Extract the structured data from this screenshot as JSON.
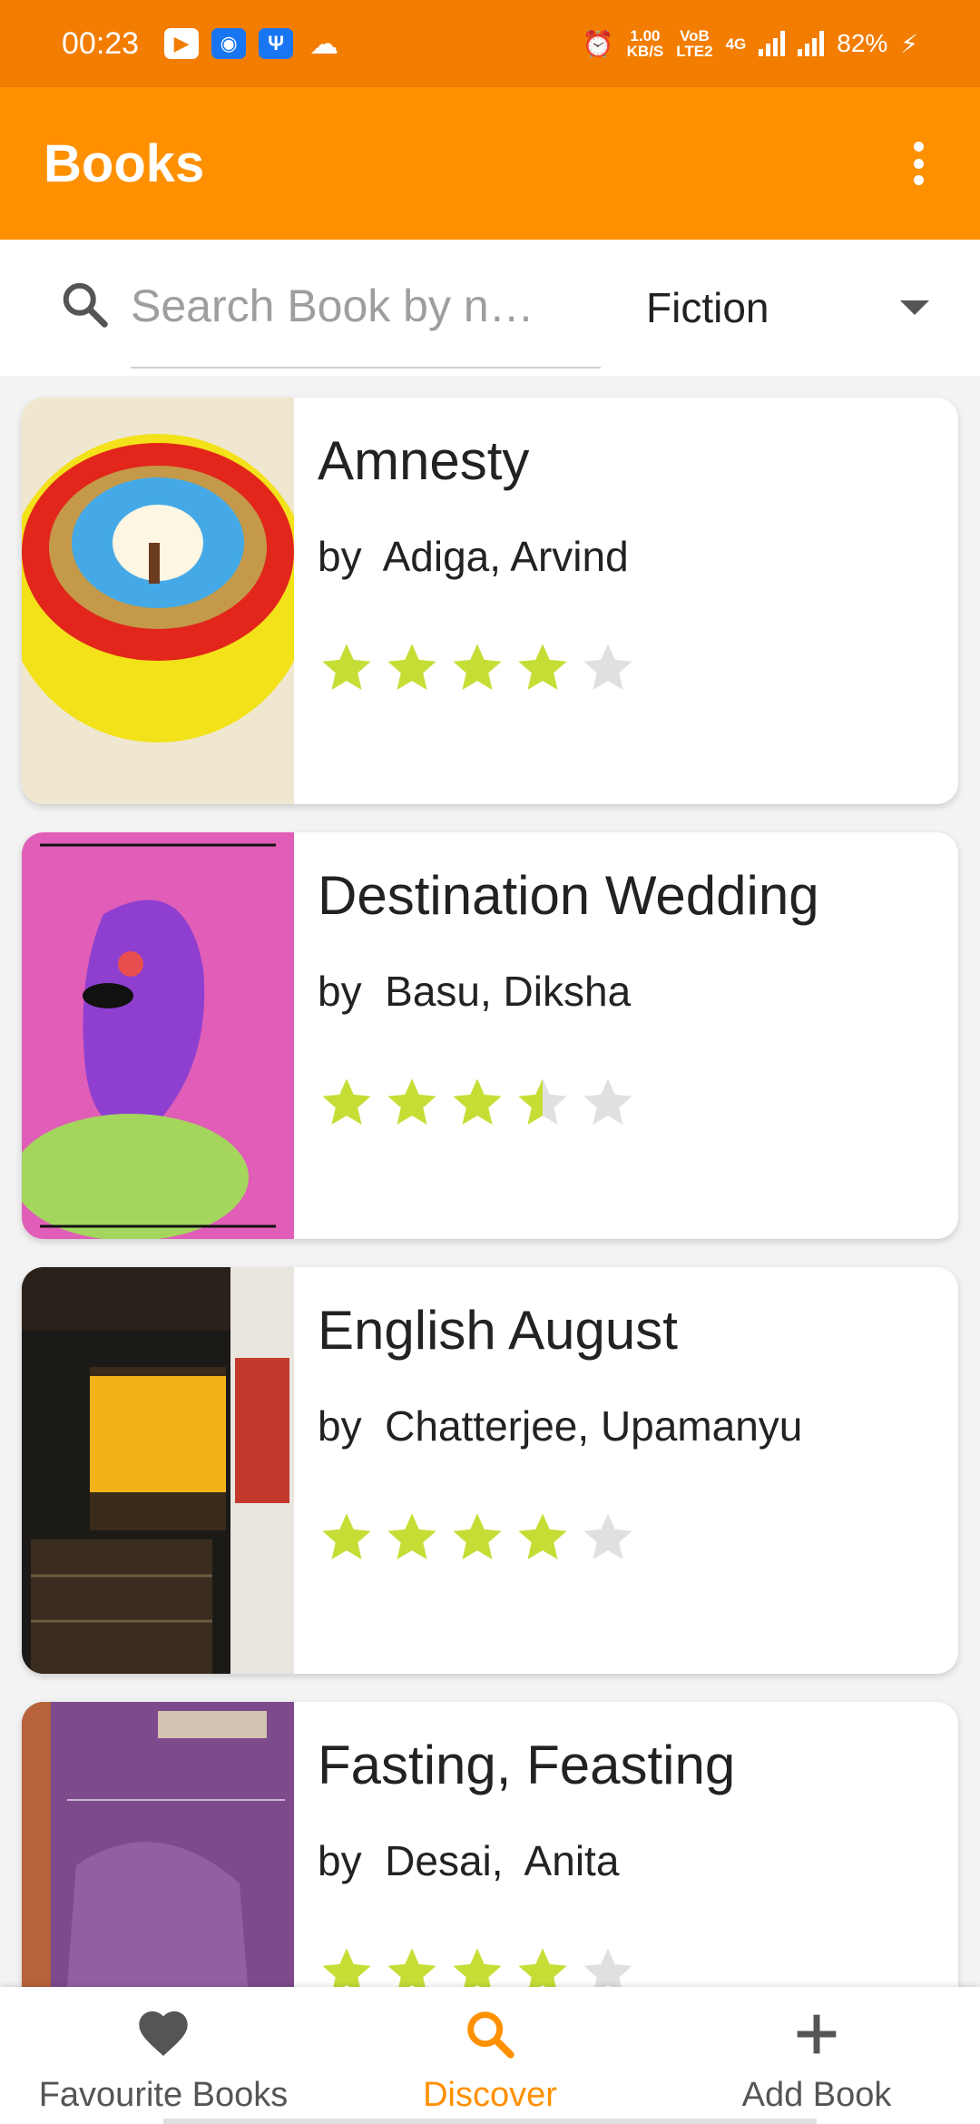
{
  "status_bar": {
    "time": "00:23",
    "net_speed_value": "1.00",
    "net_speed_unit": "KB/S",
    "volte_top": "VoB",
    "volte_bottom": "LTE2",
    "network": "4G",
    "battery": "82%"
  },
  "app_bar": {
    "title": "Books"
  },
  "search": {
    "placeholder": "Search Book by n…",
    "genre_selected": "Fiction"
  },
  "books": [
    {
      "title": "Amnesty",
      "author": "by  Adiga, Arvind",
      "rating": 4,
      "max_rating": 5,
      "cover_colors": [
        "#f3e21a",
        "#e2261b",
        "#44a9e6"
      ]
    },
    {
      "title": "Destination Wedding",
      "author": "by  Basu, Diksha",
      "rating": 3.5,
      "max_rating": 5,
      "cover_colors": [
        "#e05eb7",
        "#8e3fd0",
        "#a4d65e"
      ]
    },
    {
      "title": "English August",
      "author": "by  Chatterjee, Upamanyu",
      "rating": 4,
      "max_rating": 5,
      "cover_colors": [
        "#1b1a17",
        "#f3b318",
        "#c33a2c"
      ]
    },
    {
      "title": "Fasting, Feasting",
      "author": "by  Desai,  Anita",
      "rating": 4,
      "max_rating": 5,
      "cover_colors": [
        "#7d4a8c",
        "#b7623a",
        "#d3c3b0"
      ]
    }
  ],
  "bottom_nav": [
    {
      "label": "Favourite Books",
      "icon": "heart-icon",
      "active": false
    },
    {
      "label": "Discover",
      "icon": "search-icon",
      "active": true
    },
    {
      "label": "Add Book",
      "icon": "plus-icon",
      "active": false
    }
  ],
  "colors": {
    "status_bar": "#f27d00",
    "app_bar": "#ff9000",
    "star_filled": "#c6dd36",
    "star_empty": "#e0e0e0",
    "nav_active": "#ff9000",
    "nav_inactive": "#555555"
  }
}
